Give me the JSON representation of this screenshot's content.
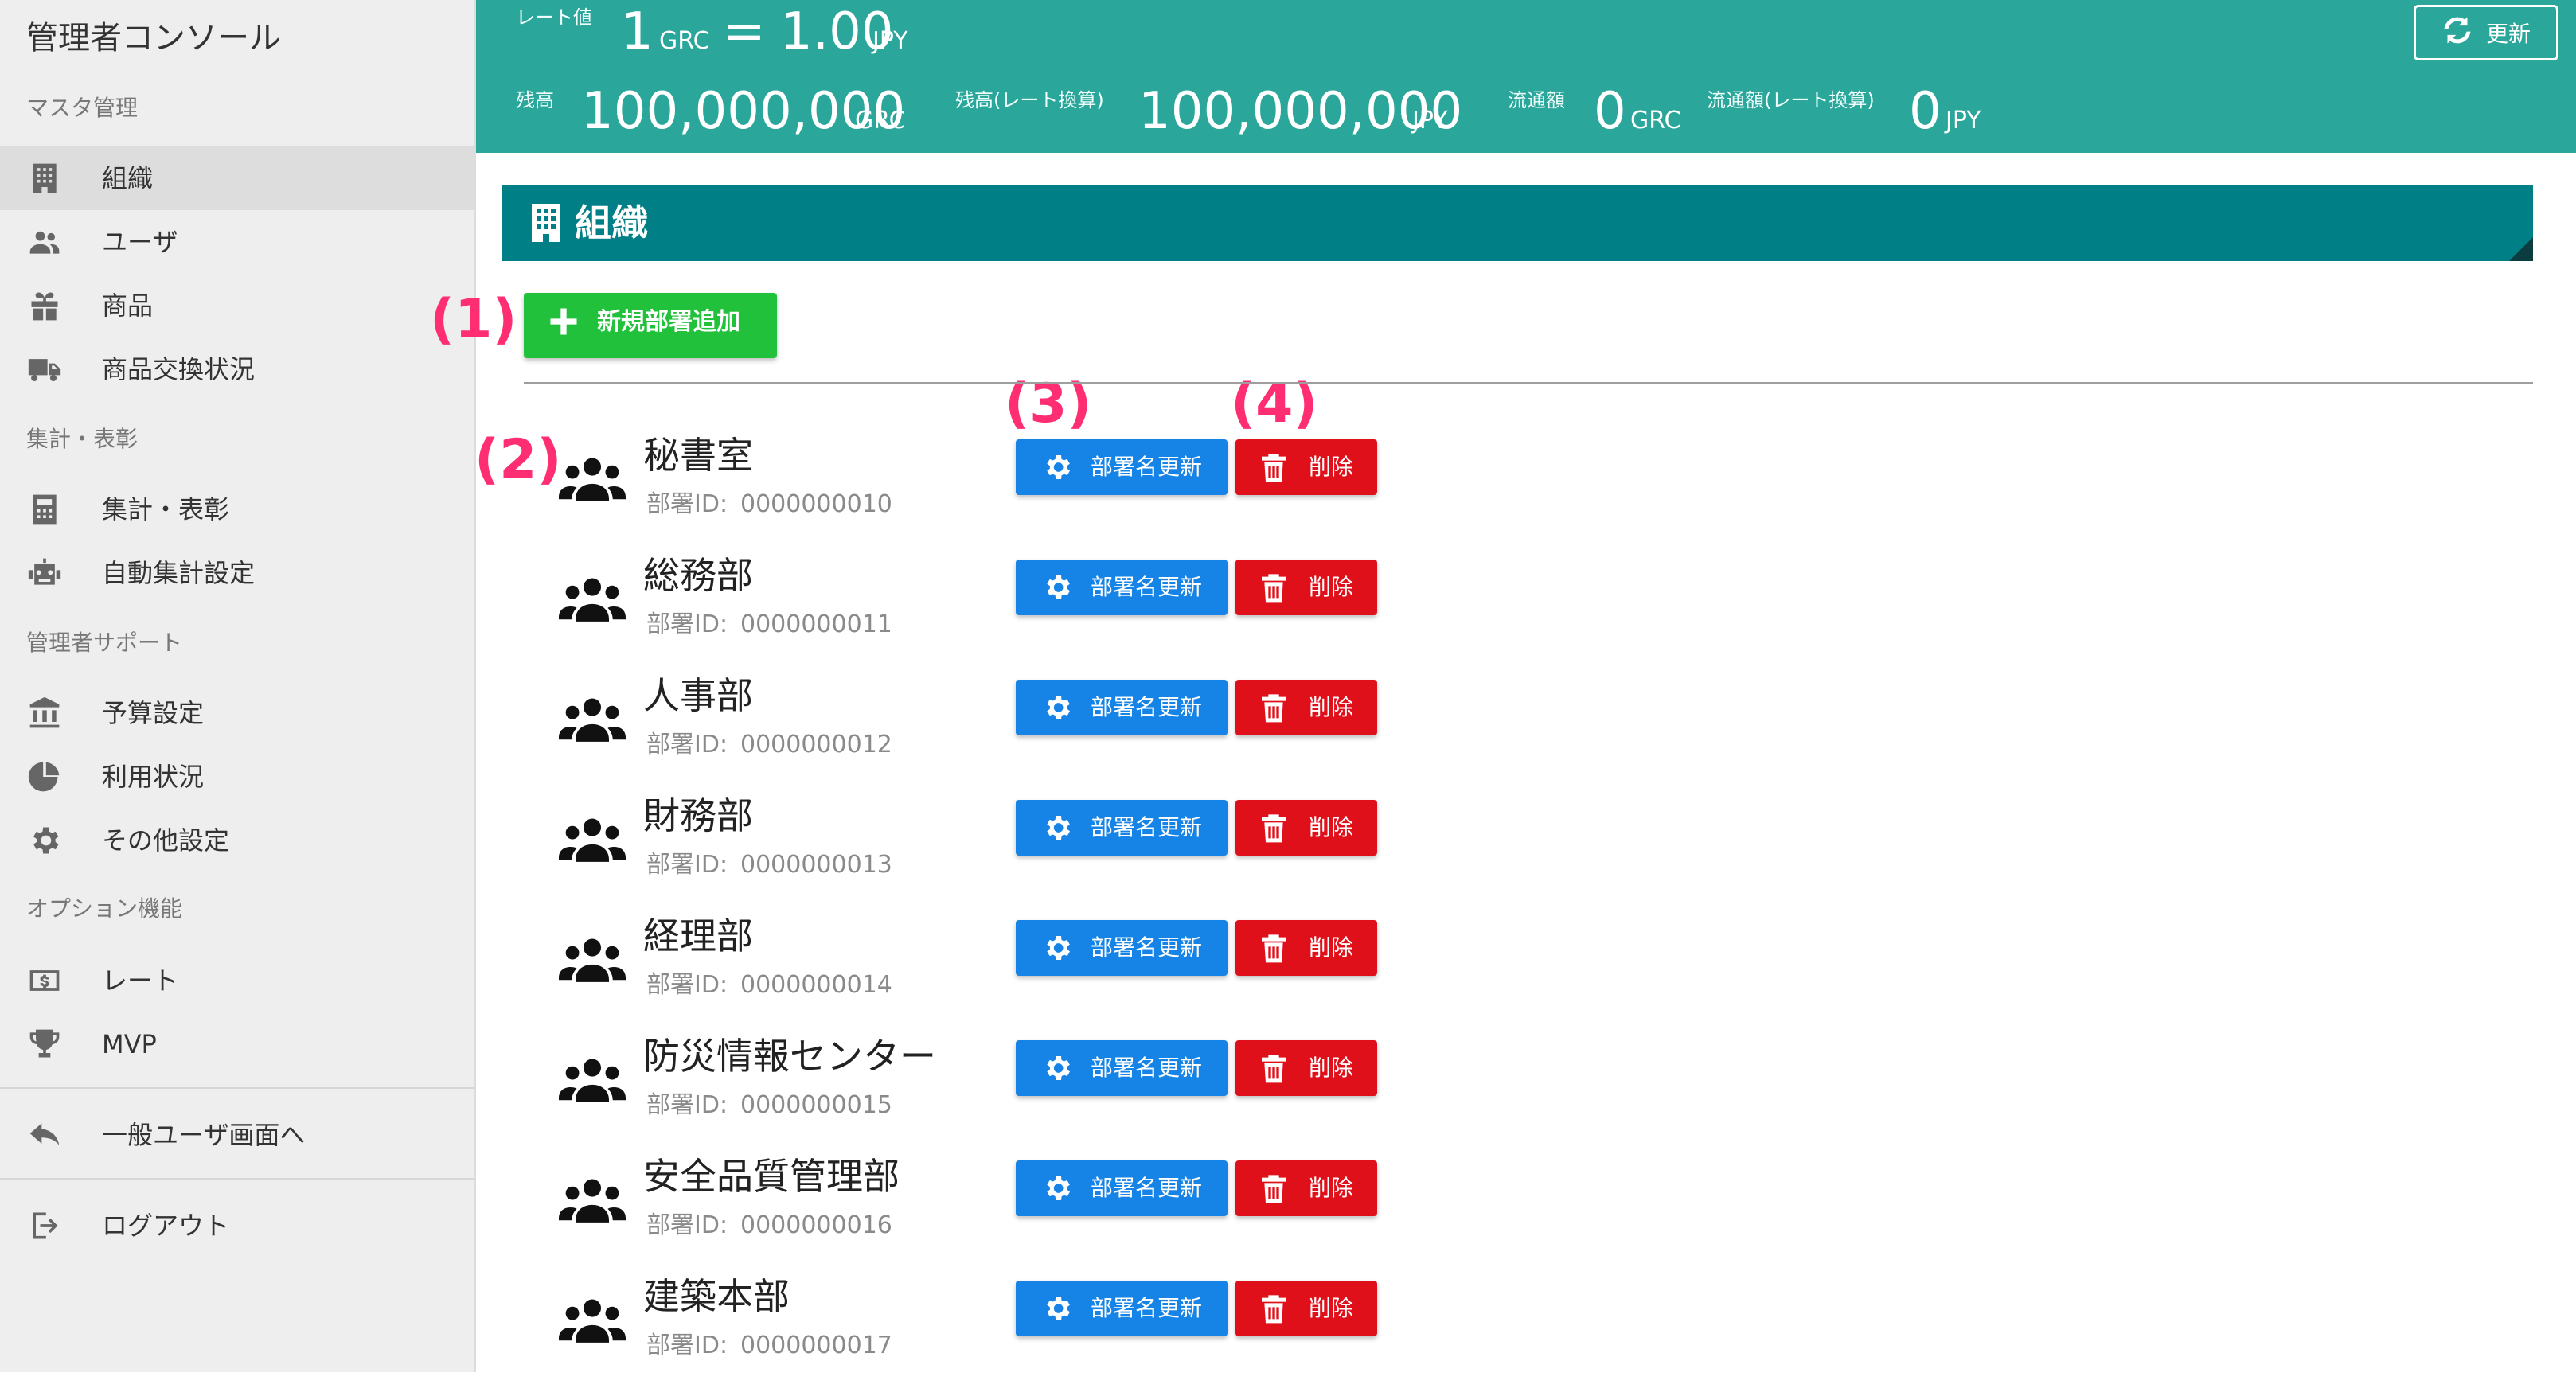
{
  "app": {
    "title": "管理者コンソール"
  },
  "sidebar": {
    "sections": [
      {
        "label": "マスタ管理"
      },
      {
        "label": "集計・表彰"
      },
      {
        "label": "管理者サポート"
      },
      {
        "label": "オプション機能"
      }
    ],
    "items": [
      {
        "label": "組織",
        "icon": "building-icon",
        "active": true
      },
      {
        "label": "ユーザ",
        "icon": "users-icon"
      },
      {
        "label": "商品",
        "icon": "gift-icon"
      },
      {
        "label": "商品交換状況",
        "icon": "truck-icon"
      },
      {
        "label": "集計・表彰",
        "icon": "calculator-icon"
      },
      {
        "label": "自動集計設定",
        "icon": "robot-icon"
      },
      {
        "label": "予算設定",
        "icon": "bank-icon"
      },
      {
        "label": "利用状況",
        "icon": "pie-chart-icon"
      },
      {
        "label": "その他設定",
        "icon": "gear-icon"
      },
      {
        "label": "レート",
        "icon": "dollar-bill-icon"
      },
      {
        "label": "MVP",
        "icon": "trophy-icon"
      },
      {
        "label": "一般ユーザ画面へ",
        "icon": "reply-icon"
      },
      {
        "label": "ログアウト",
        "icon": "logout-icon"
      }
    ]
  },
  "header": {
    "rate_label": "レート値",
    "rate_left_value": "1",
    "rate_left_unit": "GRC",
    "rate_equals": "=",
    "rate_right_value": "1.00",
    "rate_right_unit": "JPY",
    "balance_label": "残高",
    "balance_value": "100,000,000",
    "balance_unit": "GRC",
    "balance_conv_label": "残高(レート換算)",
    "balance_conv_value": "100,000,000",
    "balance_conv_unit": "JPY",
    "circulation_label": "流通額",
    "circulation_value": "0",
    "circulation_unit": "GRC",
    "circulation_conv_label": "流通額(レート換算)",
    "circulation_conv_value": "0",
    "circulation_conv_unit": "JPY",
    "refresh_label": "更新",
    "accent_color": "#2aa69a"
  },
  "page": {
    "title": "組織",
    "title_bar_color": "#007f86",
    "add_button_label": "新規部署追加",
    "markers": [
      "(1)",
      "(2)",
      "(3)",
      "(4)"
    ]
  },
  "departments": {
    "id_label": "部署ID:",
    "rename_label": "部署名更新",
    "delete_label": "削除",
    "rows": [
      {
        "name": "秘書室",
        "id": "0000000010"
      },
      {
        "name": "総務部",
        "id": "0000000011"
      },
      {
        "name": "人事部",
        "id": "0000000012"
      },
      {
        "name": "財務部",
        "id": "0000000013"
      },
      {
        "name": "経理部",
        "id": "0000000014"
      },
      {
        "name": "防災情報センター",
        "id": "0000000015"
      },
      {
        "name": "安全品質管理部",
        "id": "0000000016"
      },
      {
        "name": "建築本部",
        "id": "0000000017"
      }
    ]
  }
}
